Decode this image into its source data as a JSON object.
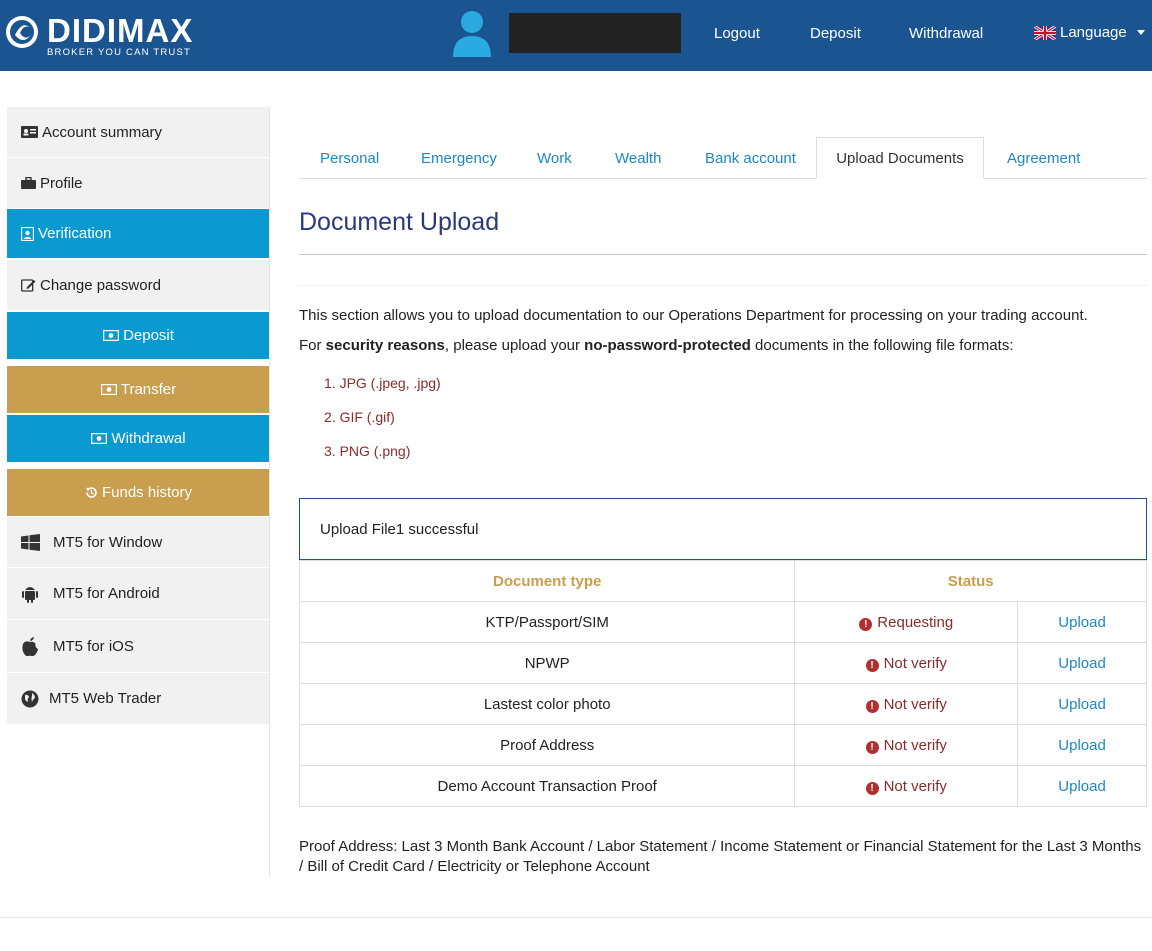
{
  "header": {
    "logo_text": "DIDIMAX",
    "logo_tagline": "BROKER YOU CAN TRUST",
    "nav": {
      "logout": "Logout",
      "deposit": "Deposit",
      "withdrawal": "Withdrawal",
      "language": "Language"
    }
  },
  "sidebar": {
    "items": [
      {
        "label": "Account summary",
        "icon": "id-card-icon"
      },
      {
        "label": "Profile",
        "icon": "briefcase-icon"
      },
      {
        "label": "Verification",
        "icon": "user-badge-icon"
      },
      {
        "label": "Change password",
        "icon": "edit-icon"
      },
      {
        "label": "Deposit",
        "icon": "money-icon"
      },
      {
        "label": "Transfer",
        "icon": "money-icon"
      },
      {
        "label": "Withdrawal",
        "icon": "money-icon"
      },
      {
        "label": "Funds history",
        "icon": "history-icon"
      },
      {
        "label": "MT5 for Window",
        "icon": "windows-icon"
      },
      {
        "label": "MT5 for Android",
        "icon": "android-icon"
      },
      {
        "label": "MT5 for iOS",
        "icon": "apple-icon"
      },
      {
        "label": "MT5 Web Trader",
        "icon": "globe-icon"
      }
    ]
  },
  "tabs": [
    "Personal",
    "Emergency",
    "Work",
    "Wealth",
    "Bank account",
    "Upload Documents",
    "Agreement"
  ],
  "active_tab": "Upload Documents",
  "main": {
    "title": "Document Upload",
    "intro": "This section allows you to upload documentation to our Operations Department for processing on your trading account.",
    "formats_p1": "For ",
    "formats_b1": "security reasons",
    "formats_p2": ", please upload your ",
    "formats_b2": "no-password-protected",
    "formats_p3": " documents in the following file formats:",
    "formats": [
      "1. JPG (.jpeg, .jpg)",
      "2. GIF (.gif)",
      "3. PNG (.png)"
    ],
    "alert": "Upload File1 successful",
    "table": {
      "headers": [
        "Document type",
        "Status"
      ],
      "rows": [
        {
          "type": "KTP/Passport/SIM",
          "status": "Requesting",
          "action": "Upload"
        },
        {
          "type": "NPWP",
          "status": "Not verify",
          "action": "Upload"
        },
        {
          "type": "Lastest color photo",
          "status": "Not verify",
          "action": "Upload"
        },
        {
          "type": "Proof Address",
          "status": "Not verify",
          "action": "Upload"
        },
        {
          "type": "Demo Account Transaction Proof",
          "status": "Not verify",
          "action": "Upload"
        }
      ]
    },
    "note": "Proof Address: Last 3 Month Bank Account / Labor Statement / Income Statement or Financial Statement for the Last 3 Months / Bill of Credit Card / Electricity or Telephone Account"
  },
  "colors": {
    "header_bg": "#1b5591",
    "sidebar_blue": "#0a9ad1",
    "sidebar_gold": "#c99e4f",
    "link": "#1e88c2",
    "status_red": "#8a2a2a"
  }
}
